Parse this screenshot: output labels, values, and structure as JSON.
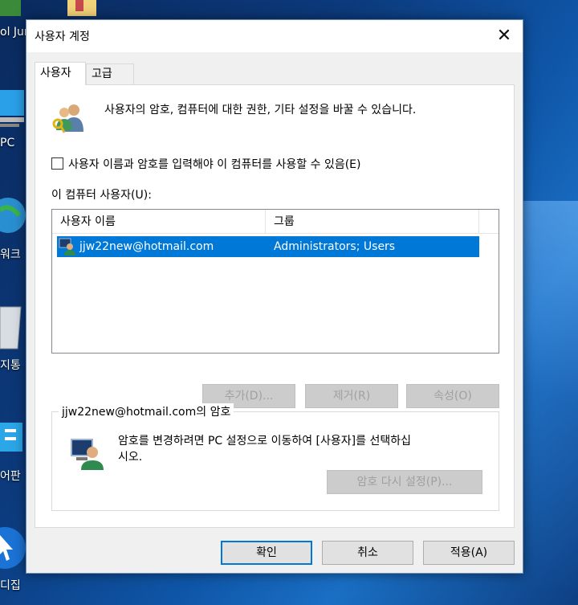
{
  "desktop": {
    "labels": [
      "ol Jur",
      "PC",
      "워크",
      "지통",
      "어판",
      "디집"
    ]
  },
  "dialog": {
    "title": "사용자 계정",
    "close_glyph": "✕",
    "tabs": [
      {
        "label": "사용자"
      },
      {
        "label": "고급"
      }
    ],
    "header_text": "사용자의 암호, 컴퓨터에 대한 권한, 기타 설정을 바꿀 수 있습니다.",
    "require_login": {
      "label": "사용자 이름과 암호를 입력해야 이 컴퓨터를 사용할 수 있음(E)",
      "checked": false
    },
    "users_label": "이 컴퓨터 사용자(U):",
    "columns": [
      "사용자 이름",
      "그룹"
    ],
    "rows": [
      {
        "user": "jjw22new@hotmail.com",
        "group": "Administrators; Users",
        "selected": true
      }
    ],
    "list_buttons": {
      "add": "추가(D)...",
      "remove": "제거(R)",
      "properties": "속성(O)"
    },
    "password_group": {
      "title": "jjw22new@hotmail.com의 암호",
      "text_line1": "암호를 변경하려면 PC 설정으로 이동하여 [사용자]를 선택하십",
      "text_line2": "시오.",
      "reset_button": "암호 다시 설정(P)..."
    },
    "footer_buttons": {
      "ok": "확인",
      "cancel": "취소",
      "apply": "적용(A)"
    }
  },
  "colors": {
    "selection": "#0078d7",
    "dialog_bg": "#f0f0f0"
  }
}
